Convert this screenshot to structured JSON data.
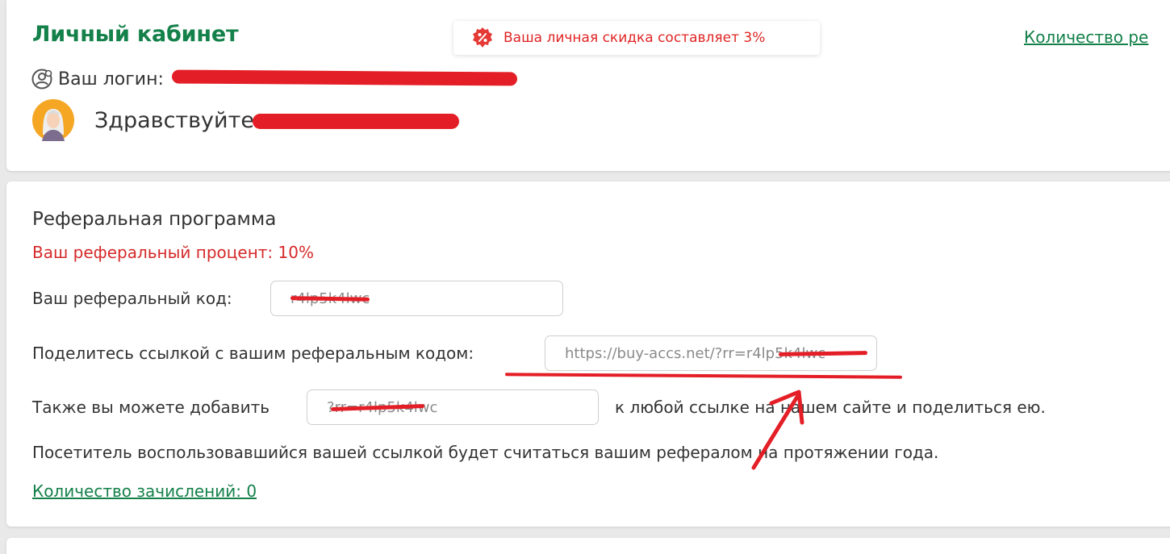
{
  "header": {
    "title": "Личный кабинет",
    "discount_text": "Ваша личная скидка составляет 3%",
    "discount_icon": "percent-badge-icon",
    "top_link": "Количество ре",
    "login_label": "Ваш логин:",
    "login_value": "",
    "greeting": "Здравствуйте",
    "colors": {
      "brand_green": "#14804a",
      "alert_red": "#e02424"
    }
  },
  "referral": {
    "title": "Реферальная программа",
    "percent_text": "Ваш реферальный процент: 10%",
    "code_label": "Ваш реферальный код:",
    "code_value": "r4lp5k4lwc",
    "share_label": "Поделитесь ссылкой с вашим реферальным кодом:",
    "share_value": "https://buy-accs.net/?rr=r4lp5k4lwc",
    "add_label": "Также вы можете добавить",
    "add_value": "?rr=r4lp5k4lwc",
    "add_suffix": "к любой ссылке на нашем сайте и поделиться ею.",
    "note": "Посетитель воспользовавшийся вашей ссылкой будет считаться вашим рефералом на протяжении года.",
    "credits_link": "Количество зачислений: 0"
  }
}
